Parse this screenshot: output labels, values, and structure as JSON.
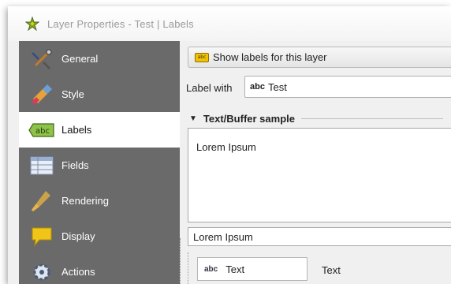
{
  "window": {
    "title": "Layer Properties - Test | Labels"
  },
  "sidebar": {
    "items": [
      {
        "label": "General",
        "icon": "general-icon"
      },
      {
        "label": "Style",
        "icon": "style-icon"
      },
      {
        "label": "Labels",
        "icon": "labels-icon",
        "active": true
      },
      {
        "label": "Fields",
        "icon": "fields-icon"
      },
      {
        "label": "Rendering",
        "icon": "rendering-icon"
      },
      {
        "label": "Display",
        "icon": "display-icon"
      },
      {
        "label": "Actions",
        "icon": "actions-icon"
      }
    ]
  },
  "main": {
    "show_labels_button": "Show labels for this layer",
    "label_with_caption": "Label with",
    "label_with_value": "Test",
    "label_with_prefix": "abc",
    "section_title": "Text/Buffer sample",
    "sample_preview_text": "Lorem Ipsum",
    "sample_input_value": "Lorem Ipsum",
    "tabs": [
      {
        "label": "Text",
        "prefix": "abc"
      }
    ],
    "right_caption": "Text"
  },
  "colors": {
    "sidebar_bg": "#6a6a6a",
    "sidebar_active_bg": "#ffffff",
    "accent_yellow": "#f2c200"
  }
}
